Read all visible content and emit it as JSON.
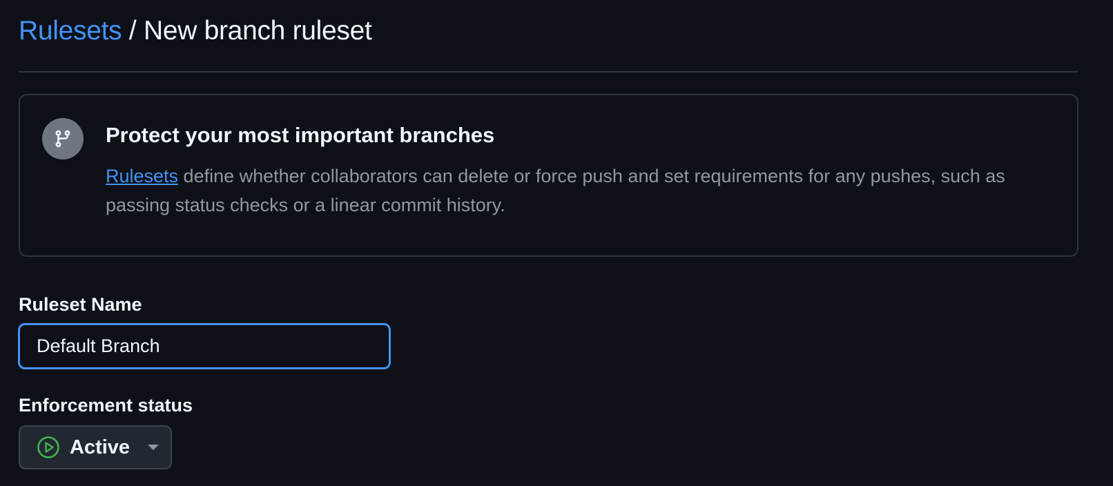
{
  "breadcrumb": {
    "parent_label": "Rulesets",
    "separator": " / ",
    "current_label": "New branch ruleset"
  },
  "banner": {
    "icon": "git-branch-icon",
    "title": "Protect your most important branches",
    "link_label": "Rulesets",
    "body_text": " define whether collaborators can delete or force push and set requirements for any pushes, such as passing status checks or a linear commit history."
  },
  "form": {
    "name_label": "Ruleset Name",
    "name_value": "Default Branch",
    "status_label": "Enforcement status",
    "status_value": "Active",
    "status_icon": "play-circle-icon",
    "status_color": "#3fb950"
  },
  "colors": {
    "background": "#0d1117",
    "accent": "#4493f8",
    "border": "#30363d",
    "muted_text": "#9198a1"
  }
}
